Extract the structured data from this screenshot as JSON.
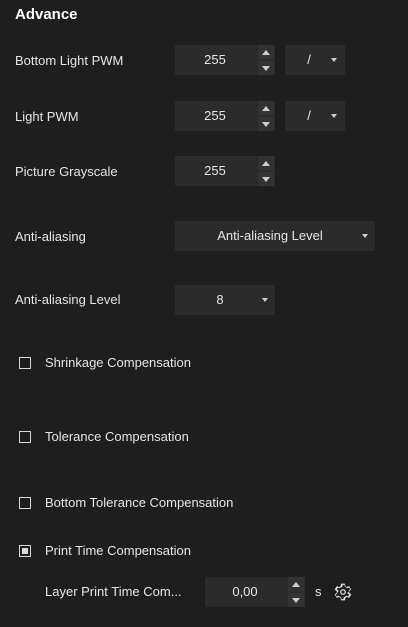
{
  "section_title": "Advance",
  "bottom_light_pwm": {
    "label": "Bottom Light PWM",
    "value": "255",
    "dropdown_value": "/"
  },
  "light_pwm": {
    "label": "Light PWM",
    "value": "255",
    "dropdown_value": "/"
  },
  "picture_grayscale": {
    "label": "Picture Grayscale",
    "value": "255"
  },
  "anti_aliasing": {
    "label": "Anti-aliasing",
    "dropdown_value": "Anti-aliasing Level"
  },
  "anti_aliasing_level": {
    "label": "Anti-aliasing Level",
    "dropdown_value": "8"
  },
  "checkboxes": [
    {
      "label": "Shrinkage Compensation",
      "checked": false
    },
    {
      "label": "Tolerance Compensation",
      "checked": false
    },
    {
      "label": "Bottom Tolerance Compensation",
      "checked": false
    },
    {
      "label": "Print Time Compensation",
      "checked": true
    }
  ],
  "layer_print_time": {
    "label": "Layer Print Time Com...",
    "value": "0,00",
    "unit": "s",
    "settings_icon": "gear-icon"
  },
  "colors": {
    "background": "#1e1e1e",
    "field_background": "#2b2b2b",
    "text": "#e6e6e6"
  }
}
